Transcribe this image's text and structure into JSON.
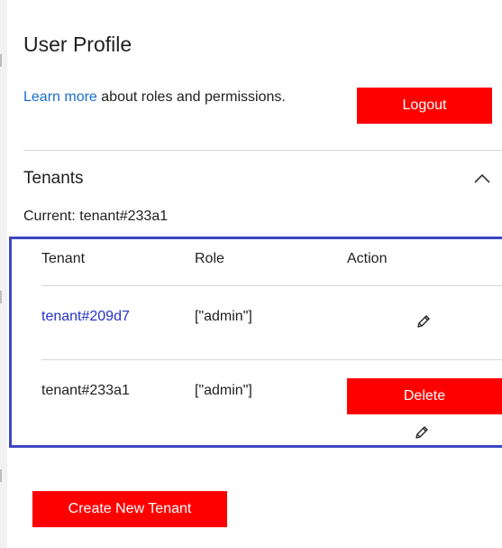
{
  "profile": {
    "title": "User Profile",
    "learn_link": "Learn more",
    "learn_text": " about roles and permissions.",
    "logout_label": "Logout"
  },
  "tenants": {
    "heading": "Tenants",
    "current_label": "Current: ",
    "current_value": "tenant#233a1",
    "columns": [
      "Tenant",
      "Role",
      "Action"
    ],
    "rows": [
      {
        "tenant": "tenant#209d7",
        "role": "[\"admin\"]",
        "is_link": true
      },
      {
        "tenant": "tenant#233a1",
        "role": "[\"admin\"]",
        "is_link": false,
        "action_label": "Delete"
      }
    ],
    "create_label": "Create New Tenant"
  },
  "icons": {
    "collapse": "chevron-up-icon",
    "edit": "pencil-icon"
  },
  "colors": {
    "accent_red": "#ff0000",
    "link_blue": "#1a6fc9",
    "tenant_link": "#2432c8",
    "table_border": "#3d46c2"
  }
}
